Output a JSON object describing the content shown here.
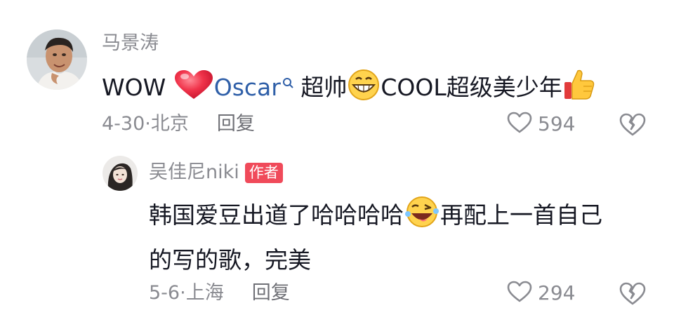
{
  "comments": [
    {
      "username": "马景涛",
      "text_prefix": "WOW ",
      "mention": "Oscar",
      "text_mid": " 超帅",
      "text_after": "COOL超级美少年",
      "date": "4-30",
      "location": "北京",
      "reply_label": "回复",
      "likes": "594",
      "emojis": [
        "heart-emoji",
        "grin-emoji",
        "thumbs-up-emoji"
      ]
    },
    {
      "username": "吴佳尼niki",
      "badge": "作者",
      "line1_prefix": "韩国爱豆出道了哈哈哈哈",
      "line1_suffix": "再配上一首自己",
      "line2": "的写的歌，完美",
      "date": "5-6",
      "location": "上海",
      "reply_label": "回复",
      "likes": "294",
      "emojis": [
        "laughing-wink-emoji"
      ]
    }
  ],
  "separator": "·",
  "colors": {
    "secondary_text": "#8a8b91",
    "primary_text": "#161823",
    "mention_link": "#2f5fa8",
    "author_badge": "#f04a5a"
  }
}
